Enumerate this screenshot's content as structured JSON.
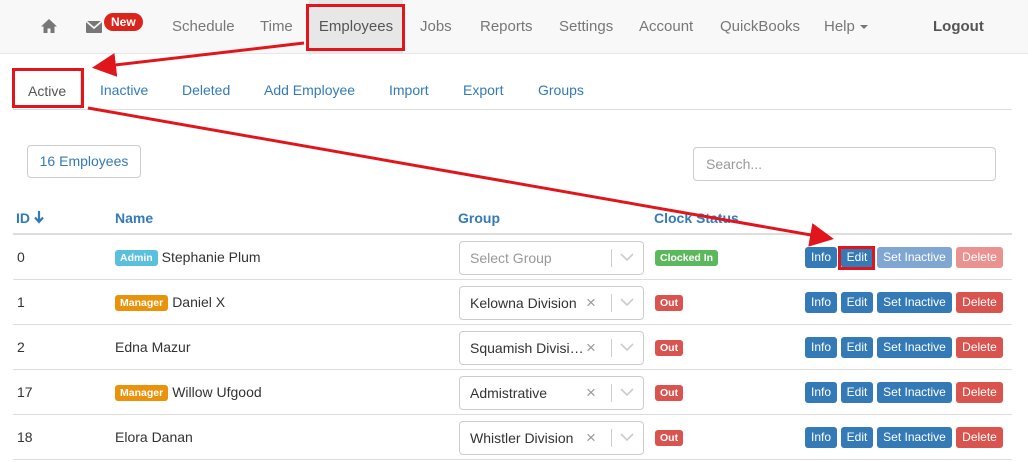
{
  "nav": {
    "home_icon": "home-icon",
    "mail_icon": "mail-icon",
    "new_badge": "New",
    "items": [
      "Schedule",
      "Time",
      "Employees",
      "Jobs",
      "Reports",
      "Settings",
      "Account",
      "QuickBooks",
      "Help"
    ],
    "logout": "Logout"
  },
  "tabs": [
    "Active",
    "Inactive",
    "Deleted",
    "Add Employee",
    "Import",
    "Export",
    "Groups"
  ],
  "toolbar": {
    "count_label": "16 Employees",
    "search_placeholder": "Search..."
  },
  "table": {
    "headers": {
      "id": "ID",
      "name": "Name",
      "group": "Group",
      "clock_status": "Clock Status"
    },
    "sort_icon": "arrow-down-icon",
    "actions": {
      "info": "Info",
      "edit": "Edit",
      "set_inactive": "Set Inactive",
      "delete": "Delete"
    },
    "rows": [
      {
        "id": "0",
        "role": "Admin",
        "name": "Stephanie Plum",
        "group": "Select Group",
        "status": "Clocked In"
      },
      {
        "id": "1",
        "role": "Manager",
        "name": "Daniel X",
        "group": "Kelowna Division",
        "status": "Out"
      },
      {
        "id": "2",
        "role": "",
        "name": "Edna Mazur",
        "group": "Squamish Division",
        "status": "Out"
      },
      {
        "id": "17",
        "role": "Manager",
        "name": "Willow Ufgood",
        "group": "Admistrative",
        "status": "Out"
      },
      {
        "id": "18",
        "role": "",
        "name": "Elora Danan",
        "group": "Whistler Division",
        "status": "Out"
      }
    ]
  },
  "colors": {
    "link": "#337ab7",
    "admin_label": "#5bc0de",
    "manager_label": "#e9930c",
    "clocked_in": "#5cb85c",
    "out": "#d9534f",
    "annotation": "#e0161c"
  }
}
